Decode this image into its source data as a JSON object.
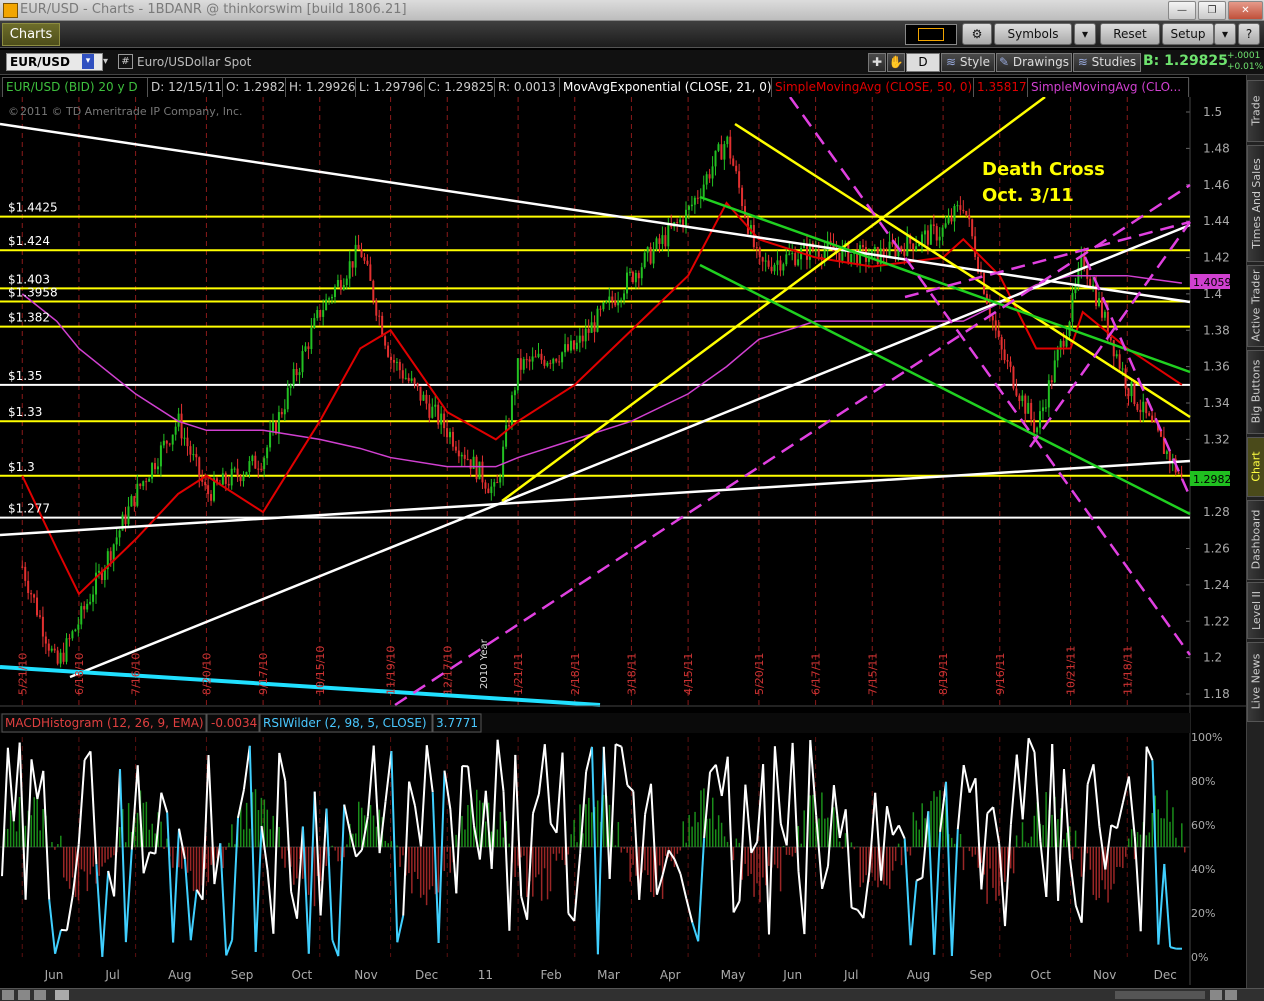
{
  "window": {
    "title": "EUR/USD - Charts - 1BDANR @ thinkorswim [build 1806.21]",
    "tab_label": "Charts"
  },
  "toolbar": {
    "symbols_label": "Symbols",
    "reset_label": "Reset",
    "setup_label": "Setup"
  },
  "symbol_bar": {
    "symbol": "EUR/USD",
    "hash": "#",
    "description": "Euro/USDollar Spot",
    "period_button": "D",
    "style_label": "Style",
    "drawings_label": "Drawings",
    "studies_label": "Studies",
    "bid_text": "B: 1.29825",
    "change_top": "+.0001",
    "change_bottom": "+0.01%"
  },
  "study_bar": {
    "symbol_info": "EUR/USD (BID) 20 y D",
    "date": "D: 12/15/11",
    "open": "O: 1.2982",
    "high": "H: 1.29926",
    "low": "L: 1.29796",
    "close": "C: 1.29825",
    "range": "R: 0.0013",
    "ema_label": "MovAvgExponential (CLOSE, 21, 0)",
    "sma50_label": "SimpleMovingAvg (CLOSE, 50, 0)",
    "sma50_value": "1.35817",
    "sma200_label": "SimpleMovingAvg (CLO..."
  },
  "copyright": "2011 © TD Ameritrade IP Company, Inc.",
  "annotations": {
    "death_cross_line1": "Death Cross",
    "death_cross_line2": "Oct. 3/11",
    "year_marker": "2010 Year"
  },
  "level_labels": [
    "$1.4425",
    "$1.424",
    "$1.403",
    "$1.3958",
    "$1.382",
    "$1.35",
    "$1.33",
    "$1.3",
    "$1.277"
  ],
  "price_badges": {
    "sma200": "1.40593",
    "last": "1.29825"
  },
  "lower_panel": {
    "macd_label": "MACDHistogram (12, 26, 9, EMA)",
    "macd_value": "-0.0034",
    "rsi_label": "RSIWilder (2, 98, 5, CLOSE)",
    "rsi_value": "3.7771"
  },
  "right_tabs": [
    "Trade",
    "Times And Sales",
    "Active Trader",
    "Big Buttons",
    "Chart",
    "Dashboard",
    "Level II",
    "Live News"
  ],
  "colors": {
    "up_candle": "#22c022",
    "down_candle": "#e23030",
    "ema": "#e00000",
    "sma200": "#d040d0",
    "support_resistance": "#ffff00",
    "trendline_white": "#ffffff",
    "trendline_green": "#20d020",
    "channel_magenta": "#e040e0",
    "rsi_line": "#ffffff",
    "rsi_oversold": "#40d0ff",
    "macd_pos": "#20b020",
    "macd_neg": "#c03030",
    "cyan_line": "#20e0ff"
  },
  "chart_data": [
    {
      "type": "candlestick",
      "title": "EUR/USD (BID) 20 y D",
      "period": "daily",
      "ylim": [
        1.18,
        1.5
      ],
      "y_ticks": [
        "1.5",
        "1.48",
        "1.46",
        "1.44",
        "1.42",
        "1.4",
        "1.38",
        "1.36",
        "1.34",
        "1.32",
        "1.3",
        "1.28",
        "1.26",
        "1.24",
        "1.22",
        "1.2",
        "1.18"
      ],
      "x_labels": [
        "5/21/10",
        "6/18/10",
        "7/16/10",
        "8/20/10",
        "9/17/10",
        "10/15/10",
        "11/19/10",
        "12/17/10",
        "1/21/11",
        "2/18/11",
        "3/18/11",
        "4/15/11",
        "5/20/11",
        "6/17/11",
        "7/15/11",
        "8/19/11",
        "9/16/11",
        "10/21/11",
        "11/18/11"
      ],
      "month_labels": [
        "Jun",
        "Jul",
        "Aug",
        "Sep",
        "Oct",
        "Nov",
        "Dec",
        "11",
        "Feb",
        "Mar",
        "Apr",
        "May",
        "Jun",
        "Jul",
        "Aug",
        "Sep",
        "Oct",
        "Nov",
        "Dec"
      ],
      "x": [
        "2010-05-21",
        "2010-06-07",
        "2010-06-18",
        "2010-07-16",
        "2010-08-06",
        "2010-08-20",
        "2010-09-17",
        "2010-10-15",
        "2010-11-04",
        "2010-11-19",
        "2010-12-17",
        "2011-01-10",
        "2011-01-21",
        "2011-02-18",
        "2011-03-18",
        "2011-04-15",
        "2011-05-04",
        "2011-05-20",
        "2011-06-17",
        "2011-07-15",
        "2011-08-19",
        "2011-08-29",
        "2011-09-16",
        "2011-10-04",
        "2011-10-21",
        "2011-10-27",
        "2011-11-18",
        "2011-12-15"
      ],
      "close": [
        1.25,
        1.195,
        1.22,
        1.29,
        1.33,
        1.29,
        1.31,
        1.39,
        1.425,
        1.365,
        1.325,
        1.29,
        1.36,
        1.37,
        1.41,
        1.445,
        1.485,
        1.415,
        1.425,
        1.42,
        1.435,
        1.45,
        1.37,
        1.325,
        1.39,
        1.42,
        1.35,
        1.29825
      ],
      "series": [
        {
          "name": "MovAvgExponential (CLOSE, 21, 0)",
          "values": [
            1.3,
            1.26,
            1.235,
            1.265,
            1.29,
            1.3,
            1.28,
            1.33,
            1.37,
            1.38,
            1.335,
            1.32,
            1.33,
            1.35,
            1.38,
            1.41,
            1.45,
            1.43,
            1.42,
            1.415,
            1.42,
            1.43,
            1.41,
            1.37,
            1.37,
            1.39,
            1.37,
            1.35
          ]
        },
        {
          "name": "SimpleMovingAvg (CLOSE, 50, 0)",
          "values": [
            null,
            null,
            null,
            null,
            null,
            null,
            null,
            null,
            null,
            null,
            null,
            null,
            null,
            null,
            null,
            null,
            null,
            null,
            null,
            null,
            null,
            null,
            null,
            null,
            null,
            null,
            null,
            1.35817
          ]
        },
        {
          "name": "SimpleMovingAvg (CLOSE, 200, 0)",
          "values": [
            1.4,
            1.385,
            1.37,
            1.345,
            1.33,
            1.325,
            1.325,
            1.32,
            1.315,
            1.31,
            1.305,
            1.305,
            1.31,
            1.32,
            1.33,
            1.345,
            1.36,
            1.375,
            1.385,
            1.385,
            1.385,
            1.385,
            1.395,
            1.405,
            1.41,
            1.41,
            1.41,
            1.40593
          ]
        }
      ],
      "horizontal_levels": [
        1.4425,
        1.424,
        1.403,
        1.3958,
        1.382,
        1.35,
        1.33,
        1.3,
        1.277
      ]
    },
    {
      "type": "line",
      "title": "RSIWilder (2, 98, 5, CLOSE)",
      "ylim": [
        0,
        100
      ],
      "y_ticks": [
        "100%",
        "80%",
        "60%",
        "40%",
        "20%",
        "0%"
      ],
      "last_value": 3.7771
    },
    {
      "type": "bar",
      "title": "MACDHistogram (12, 26, 9, EMA)",
      "last_value": -0.0034
    }
  ]
}
